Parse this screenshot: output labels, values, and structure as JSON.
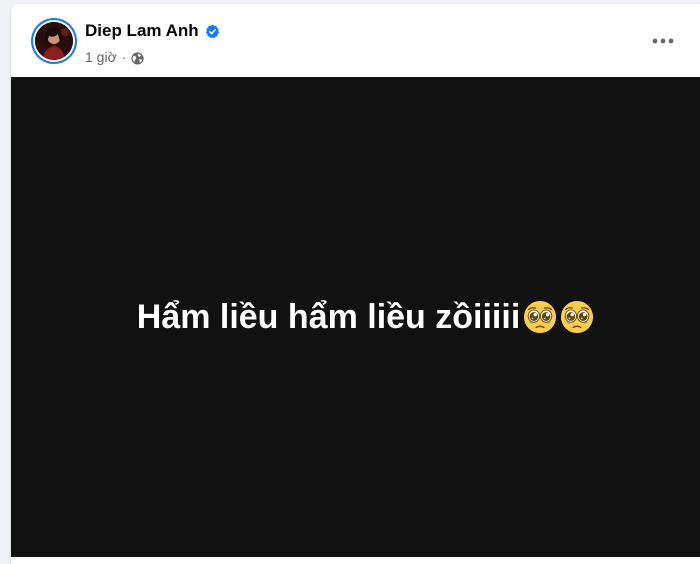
{
  "post": {
    "author_name": "Diep Lam Anh",
    "verified": true,
    "timestamp": "1 giờ",
    "separator": "·",
    "audience_icon": "globe-icon",
    "more_icon": "more-options-icon",
    "text": "Hẩm liều hẩm liều zồiiiii",
    "emojis": [
      "pleading-face-emoji",
      "pleading-face-emoji"
    ],
    "background_color": "#111111",
    "text_color": "#ffffff"
  },
  "colors": {
    "accent": "#1877f2",
    "secondary_text": "#65676b"
  }
}
